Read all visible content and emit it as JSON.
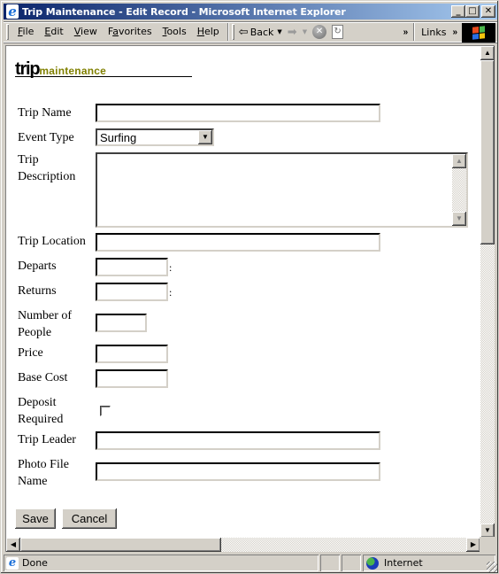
{
  "window": {
    "title": "Trip Maintenance - Edit Record - Microsoft Internet Explorer",
    "controls": {
      "minimize": "_",
      "maximize": "□",
      "close": "✕"
    }
  },
  "menu": {
    "items": [
      {
        "label": "File",
        "accel": "F",
        "rest": "ile"
      },
      {
        "label": "Edit",
        "accel": "E",
        "rest": "dit"
      },
      {
        "label": "View",
        "accel": "V",
        "rest": "iew"
      },
      {
        "label": "Favorites",
        "accel": "a",
        "pre": "F",
        "rest": "vorites"
      },
      {
        "label": "Tools",
        "accel": "T",
        "rest": "ools"
      },
      {
        "label": "Help",
        "accel": "H",
        "rest": "elp"
      }
    ]
  },
  "toolbar": {
    "back_label": "Back",
    "back_icon": "⇦",
    "forward_icon": "➡",
    "stop_icon": "✕",
    "refresh_icon": "↻",
    "chevron": "»",
    "links_label": "Links"
  },
  "logo": {
    "trip": "trip",
    "maintenance": "maintenance"
  },
  "form": {
    "trip_name": {
      "label": "Trip Name",
      "value": ""
    },
    "event_type": {
      "label": "Event Type",
      "value": "Surfing"
    },
    "trip_description": {
      "label_line1": "Trip",
      "label_line2": "Description",
      "value": ""
    },
    "trip_location": {
      "label": "Trip Location",
      "value": ""
    },
    "departs": {
      "label": "Departs",
      "value": "",
      "suffix": ":"
    },
    "returns": {
      "label": "Returns",
      "value": "",
      "suffix": ":"
    },
    "number_of_people": {
      "label_line1": "Number of",
      "label_line2": "People",
      "value": ""
    },
    "price": {
      "label": "Price",
      "value": ""
    },
    "base_cost": {
      "label": "Base Cost",
      "value": ""
    },
    "deposit_required": {
      "label_line1": "Deposit",
      "label_line2": "Required",
      "checked": false
    },
    "trip_leader": {
      "label": "Trip Leader",
      "value": ""
    },
    "photo_file_name": {
      "label_line1": "Photo File",
      "label_line2": "Name",
      "value": ""
    }
  },
  "buttons": {
    "save": "Save",
    "cancel": "Cancel"
  },
  "status": {
    "text": "Done",
    "zone": "Internet"
  },
  "colors": {
    "logo_accent": "#808000",
    "titlebar_start": "#0a246a",
    "titlebar_end": "#a6caf0"
  }
}
